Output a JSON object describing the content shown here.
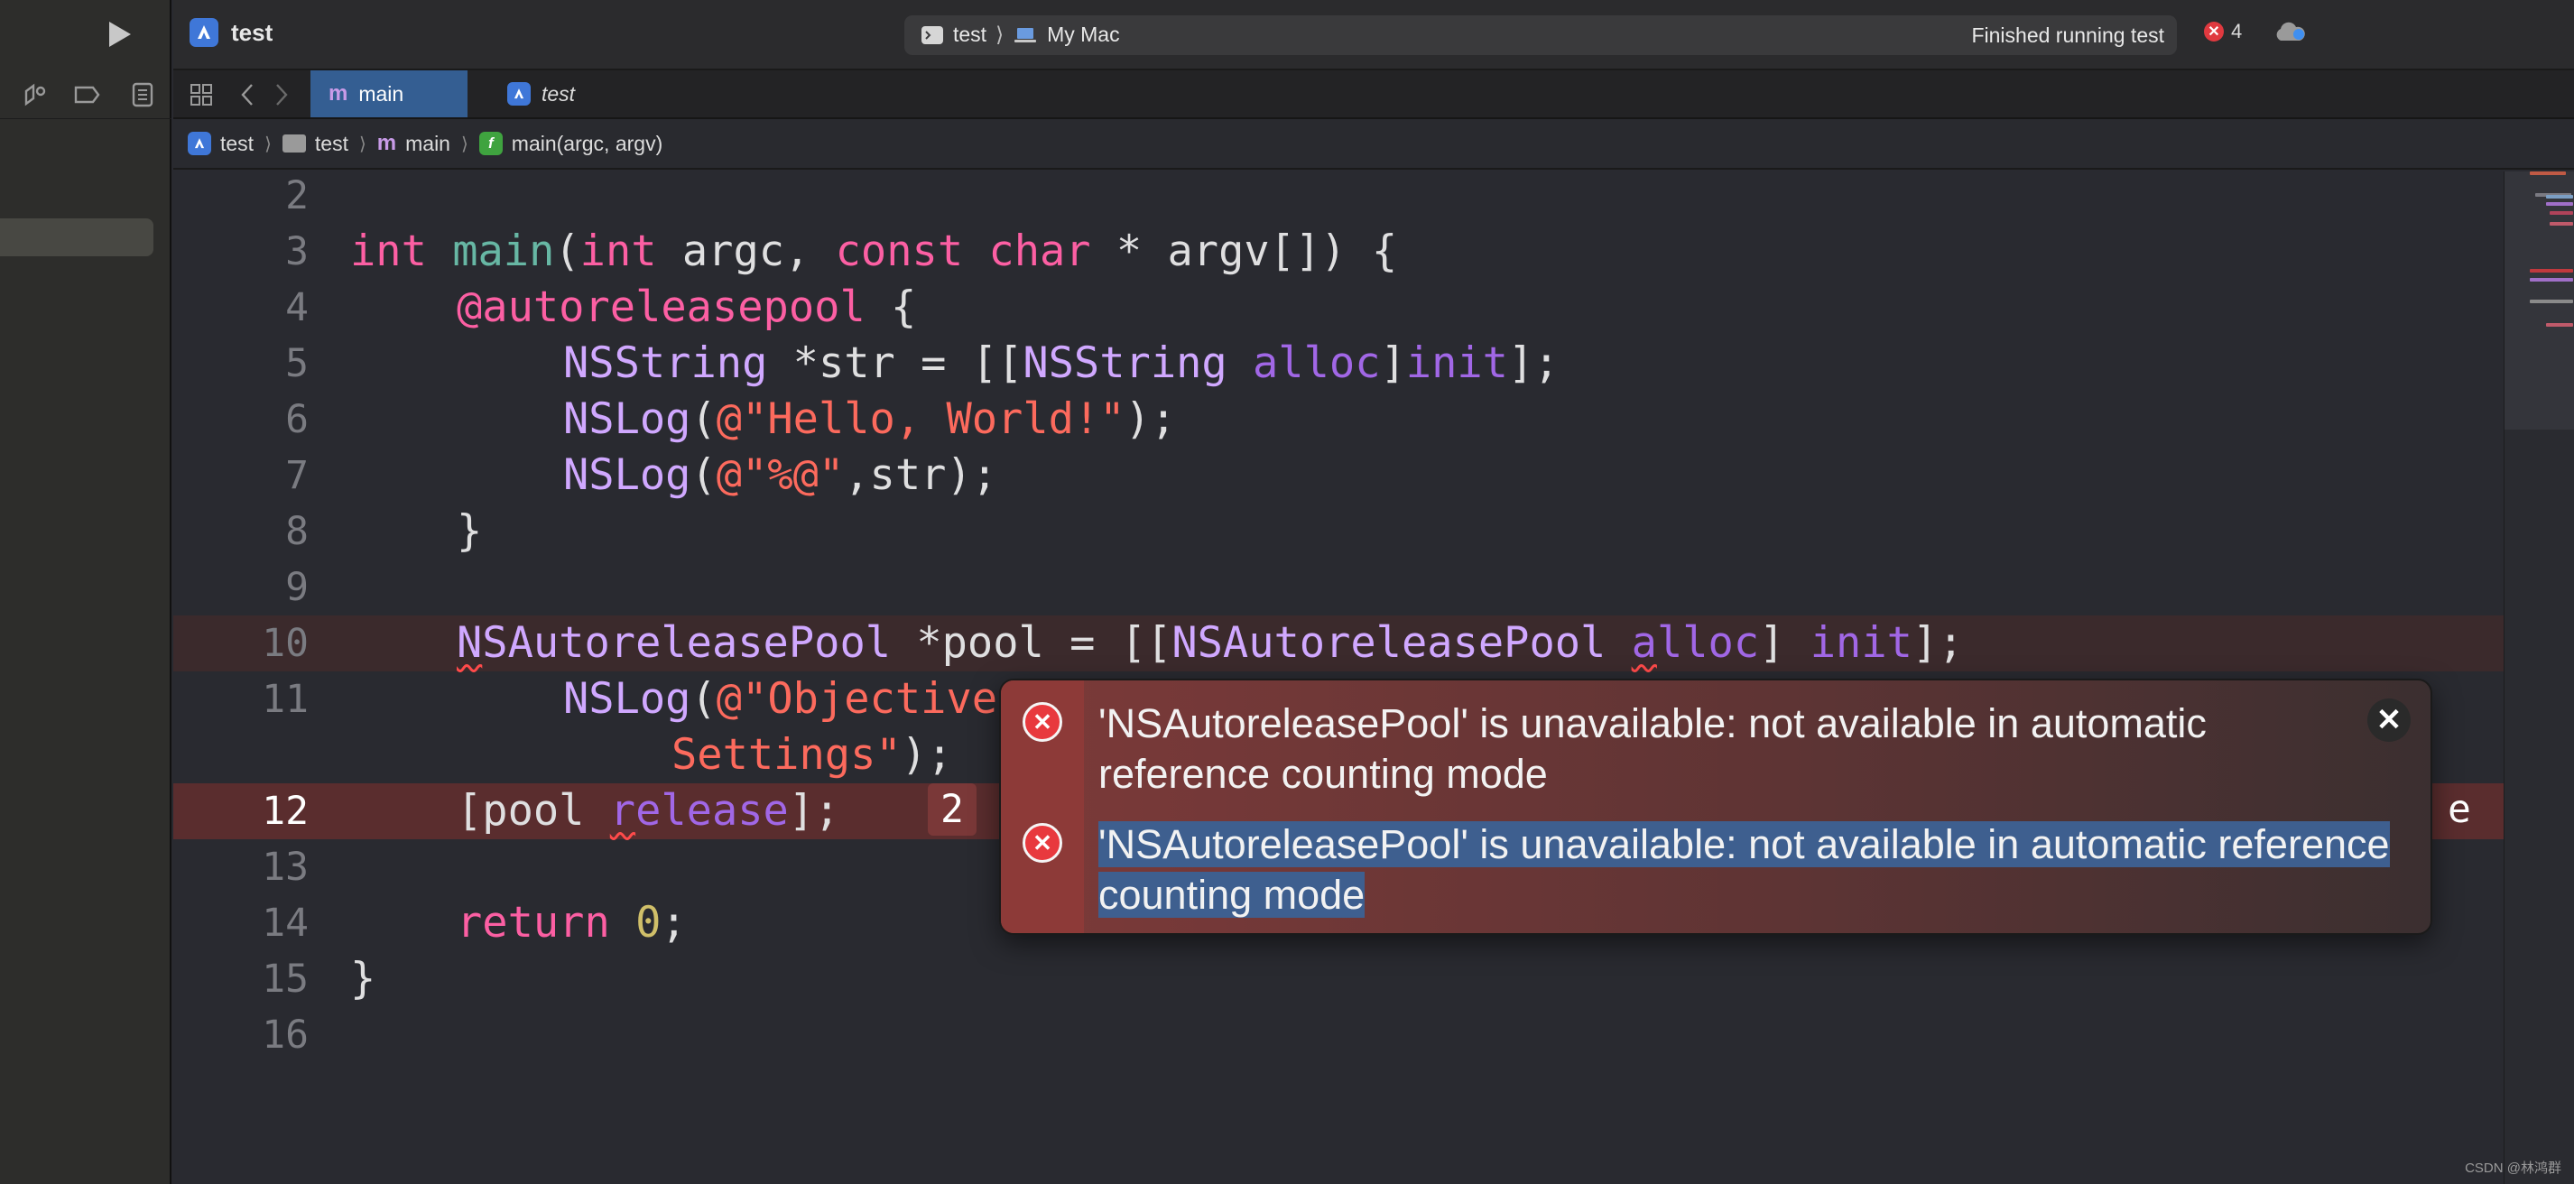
{
  "toolbar": {
    "project_title": "test",
    "scheme_target": "test",
    "scheme_destination": "My Mac",
    "status_text": "Finished running test",
    "error_count": "4"
  },
  "tabs": [
    {
      "label": "main",
      "active": true
    },
    {
      "label": "test",
      "active": false
    }
  ],
  "breadcrumb": [
    "test",
    "test",
    "main",
    "main(argc, argv)"
  ],
  "editor": {
    "line_numbers": [
      "2",
      "3",
      "4",
      "5",
      "6",
      "7",
      "8",
      "9",
      "10",
      "11",
      "12",
      "13",
      "14",
      "15",
      "16"
    ],
    "l3": {
      "kw_int": "int",
      "fn": "main",
      "open": "(",
      "kw_int2": "int",
      "argc": " argc, ",
      "kw_const": "const",
      "sp": " ",
      "kw_char": "char",
      "rest": " * argv[]) {"
    },
    "l4": {
      "kw": "@autoreleasepool",
      "rest": " {"
    },
    "l5": {
      "cls1": "NSString",
      "mid": " *str = [[",
      "cls2": "NSString",
      "sp": " ",
      "m1": "alloc",
      "br": "]",
      "m2": "init",
      "end": "];"
    },
    "l6": {
      "fn": "NSLog",
      "open": "(",
      "str": "@\"Hello, World!\"",
      "end": ");"
    },
    "l7": {
      "fn": "NSLog",
      "open": "(",
      "str": "@\"%@\"",
      "end": ",str);"
    },
    "l8": {
      "text": "}"
    },
    "l10": {
      "cls1a": "N",
      "cls1b": "SAutoreleasePool",
      "mid": " *pool = [[",
      "cls2": "NSAutoreleasePool",
      "sp": " ",
      "m1a": "a",
      "m1b": "lloc",
      "br": "] ",
      "m2": "init",
      "end": "];"
    },
    "l11": {
      "fn": "NSLog",
      "open": "(",
      "str": "@\"Objective"
    },
    "l11b": {
      "str": "Settings\"",
      "end": ");"
    },
    "l12": {
      "open": "[pool ",
      "m1a": "r",
      "m1b": "elease",
      "end": "];"
    },
    "l14": {
      "kw": "return",
      "sp": " ",
      "num": "0",
      "end": ";"
    },
    "l15": {
      "text": "}"
    },
    "inline_error_count": "2",
    "inline_error_trail": "e"
  },
  "popover": {
    "message_1": "'NSAutoreleasePool' is unavailable: not available in automatic reference counting mode",
    "message_2": "'NSAutoreleasePool' is unavailable: not available in automatic reference counting mode",
    "close_glyph": "✕",
    "error_glyph": "✕"
  },
  "watermark": "CSDN @林鸿群",
  "colors": {
    "keyword": "#fc5fa3",
    "function": "#67b7a4",
    "class": "#d0a8ff",
    "method": "#a167e6",
    "string": "#fc6a5d",
    "number": "#d0bf69",
    "error": "#e8393e",
    "selection": "#3e5f8f",
    "tab_active": "#345e92"
  },
  "icons": [
    "play-icon",
    "navigator-tools-icon",
    "tag-icon",
    "inspector-icon",
    "grid-icon",
    "back-arrow-icon",
    "forward-arrow-icon",
    "xcode-app-icon",
    "terminal-icon",
    "laptop-icon",
    "cloud-icon",
    "folder-icon",
    "function-icon",
    "error-icon",
    "close-icon"
  ]
}
